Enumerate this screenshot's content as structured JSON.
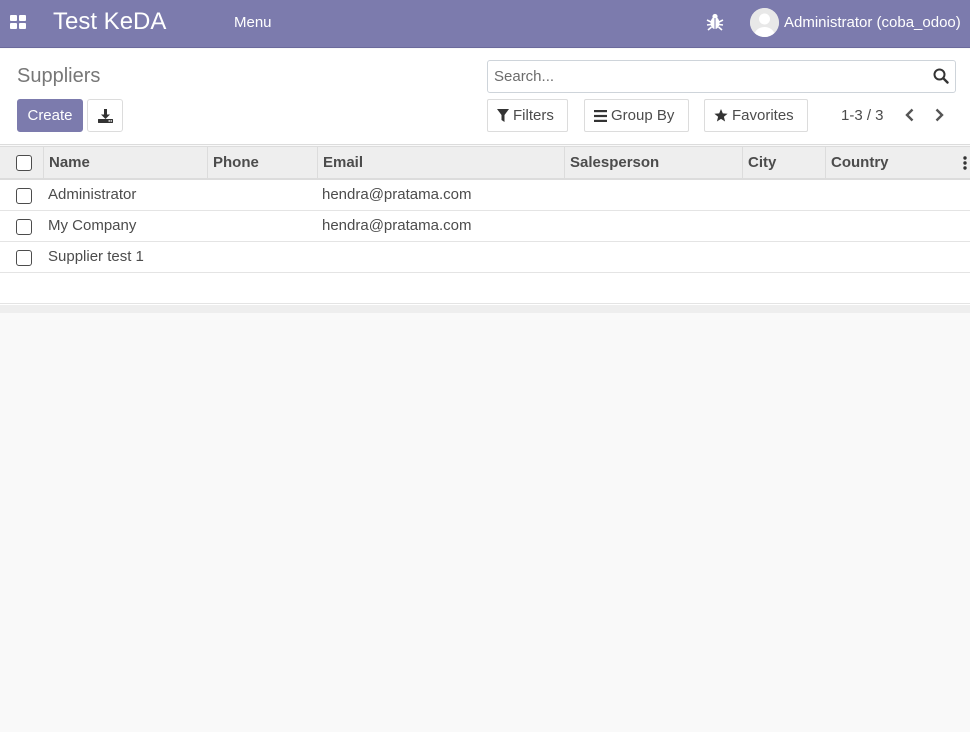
{
  "navbar": {
    "brand": "Test KeDA",
    "menu_label": "Menu",
    "apps_icon": "apps-grid-icon",
    "debug_icon": "bug-icon",
    "user_name": "Administrator (coba_odoo)"
  },
  "control_panel": {
    "title": "Suppliers",
    "create_label": "Create",
    "download_icon": "download-icon",
    "search": {
      "placeholder": "Search...",
      "value": ""
    },
    "filters_label": "Filters",
    "groupby_label": "Group By",
    "favorites_label": "Favorites",
    "pager": {
      "value": "1-3 / 3"
    }
  },
  "list": {
    "columns": [
      "Name",
      "Phone",
      "Email",
      "Salesperson",
      "City",
      "Country"
    ],
    "rows": [
      {
        "name": "Administrator",
        "phone": "",
        "email": "hendra@pratama.com",
        "salesperson": "",
        "city": "",
        "country": ""
      },
      {
        "name": "My Company",
        "phone": "",
        "email": "hendra@pratama.com",
        "salesperson": "",
        "city": "",
        "country": ""
      },
      {
        "name": "Supplier test 1",
        "phone": "",
        "email": "",
        "salesperson": "",
        "city": "",
        "country": ""
      }
    ]
  },
  "colors": {
    "brand": "#7c7bad",
    "header_bg": "#eeeeee",
    "text": "#4c4c4c"
  }
}
